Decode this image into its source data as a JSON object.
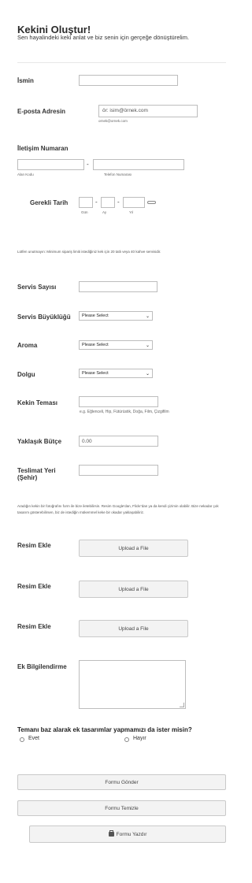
{
  "header": {
    "title": "Kekini Oluştur!",
    "subtitle": "Sen hayalindeki keki anlat ve biz senin için gerçeğe dönüştürelim."
  },
  "fields": {
    "name_label": "İsmin",
    "email_label": "E-posta Adresin",
    "email_placeholder": "ör: isim@örnek.com",
    "email_hint": "ornek@ornek.com",
    "phone_label": "İletişim Numaran",
    "area_code_label": "Alan Kodu",
    "phone_number_label": "Telefon Numarası",
    "date_label": "Gerekli Tarih",
    "day_label": "Gün",
    "month_label": "Ay",
    "year_label": "Yıl",
    "date_separator": "-",
    "phone_separator": "-",
    "min_order_note": "Lütfen unutmayın: Minimum sipariş limiti istediğiniz kek için 20 tatlı veya 40 kahve servisidir.",
    "servings_label": "Servis Sayısı",
    "serving_size_label": "Servis Büyüklüğü",
    "serving_size_value": "Please Select",
    "flavor_label": "Aroma",
    "flavor_value": "Please Select",
    "filling_label": "Dolgu",
    "filling_value": "Please Select",
    "theme_label": "Kekin Teması",
    "theme_hint": "e.g. Eğlenceli, Hip, Fütürüstik, Doğa, Film, Çizgifilm",
    "budget_label": "Yaklaşık Bütçe",
    "budget_value": "0.00",
    "delivery_label": "Teslimat Yeri (Şehir)",
    "photo_note": "Aradığın kekin bir fotoğrafını form ile bize iletebilirsin. Resim Google'dan, Flickr'dan ya da kendi çizimin olabilir. Bize nekadar çok tasarım gösterebilirsen, biz de istediğin mükemmel keke bir okadar yaklaşabiliriz.",
    "image1_label": "Resim Ekle",
    "image2_label": "Resim Ekle",
    "image3_label": "Resim Ekle",
    "upload_label": "Upload a File",
    "extra_label": "Ek Bilgilendirme"
  },
  "question": {
    "text": "Temanı baz alarak ek tasarımlar yapmamızı da ister misin?",
    "yes": "Evet",
    "no": "Hayır"
  },
  "buttons": {
    "submit": "Formu Gönder",
    "clear": "Formu Temizle",
    "print": "Formu Yazdır",
    "print_icon": "printer-icon"
  }
}
